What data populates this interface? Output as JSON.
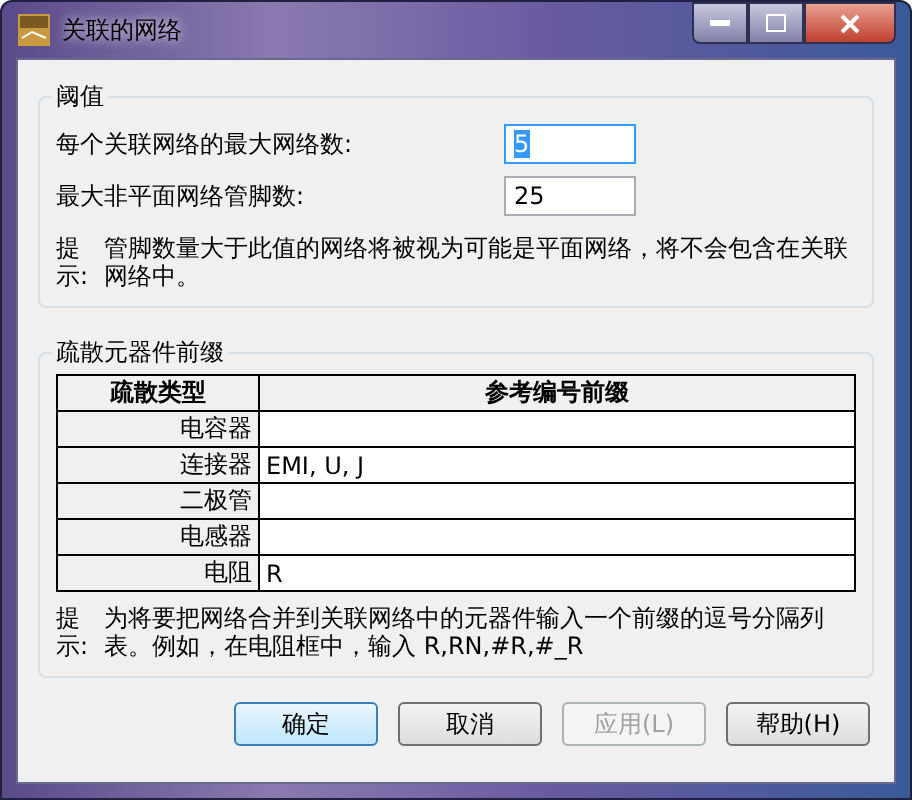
{
  "window": {
    "title": "关联的网络"
  },
  "threshold": {
    "title": "阈值",
    "fields": [
      {
        "label": "每个关联网络的最大网络数:",
        "value": "5",
        "highlighted": true
      },
      {
        "label": "最大非平面网络管脚数:",
        "value": "25",
        "highlighted": false
      }
    ],
    "hint": {
      "label": "提示:",
      "text": "管脚数量大于此值的网络将被视为可能是平面网络，将不会包含在关联网络中。"
    }
  },
  "prefixes": {
    "title": "疏散元器件前缀",
    "table": {
      "columns": [
        "疏散类型",
        "参考编号前缀"
      ],
      "rows": [
        {
          "type": "电容器",
          "prefix": ""
        },
        {
          "type": "连接器",
          "prefix": "EMI, U, J"
        },
        {
          "type": "二极管",
          "prefix": ""
        },
        {
          "type": "电感器",
          "prefix": ""
        },
        {
          "type": "电阻",
          "prefix": "R"
        }
      ]
    },
    "hint": {
      "label": "提示:",
      "text": "为将要把网络合并到关联网络中的元器件输入一个前缀的逗号分隔列表。例如，在电阻框中，输入 R,RN,#R,#_R"
    }
  },
  "buttons": [
    {
      "label": "确定",
      "default": true,
      "disabled": false
    },
    {
      "label": "取消",
      "default": false,
      "disabled": false
    },
    {
      "label": "应用(L)",
      "default": false,
      "disabled": true
    },
    {
      "label": "帮助(H)",
      "default": false,
      "disabled": false
    }
  ]
}
